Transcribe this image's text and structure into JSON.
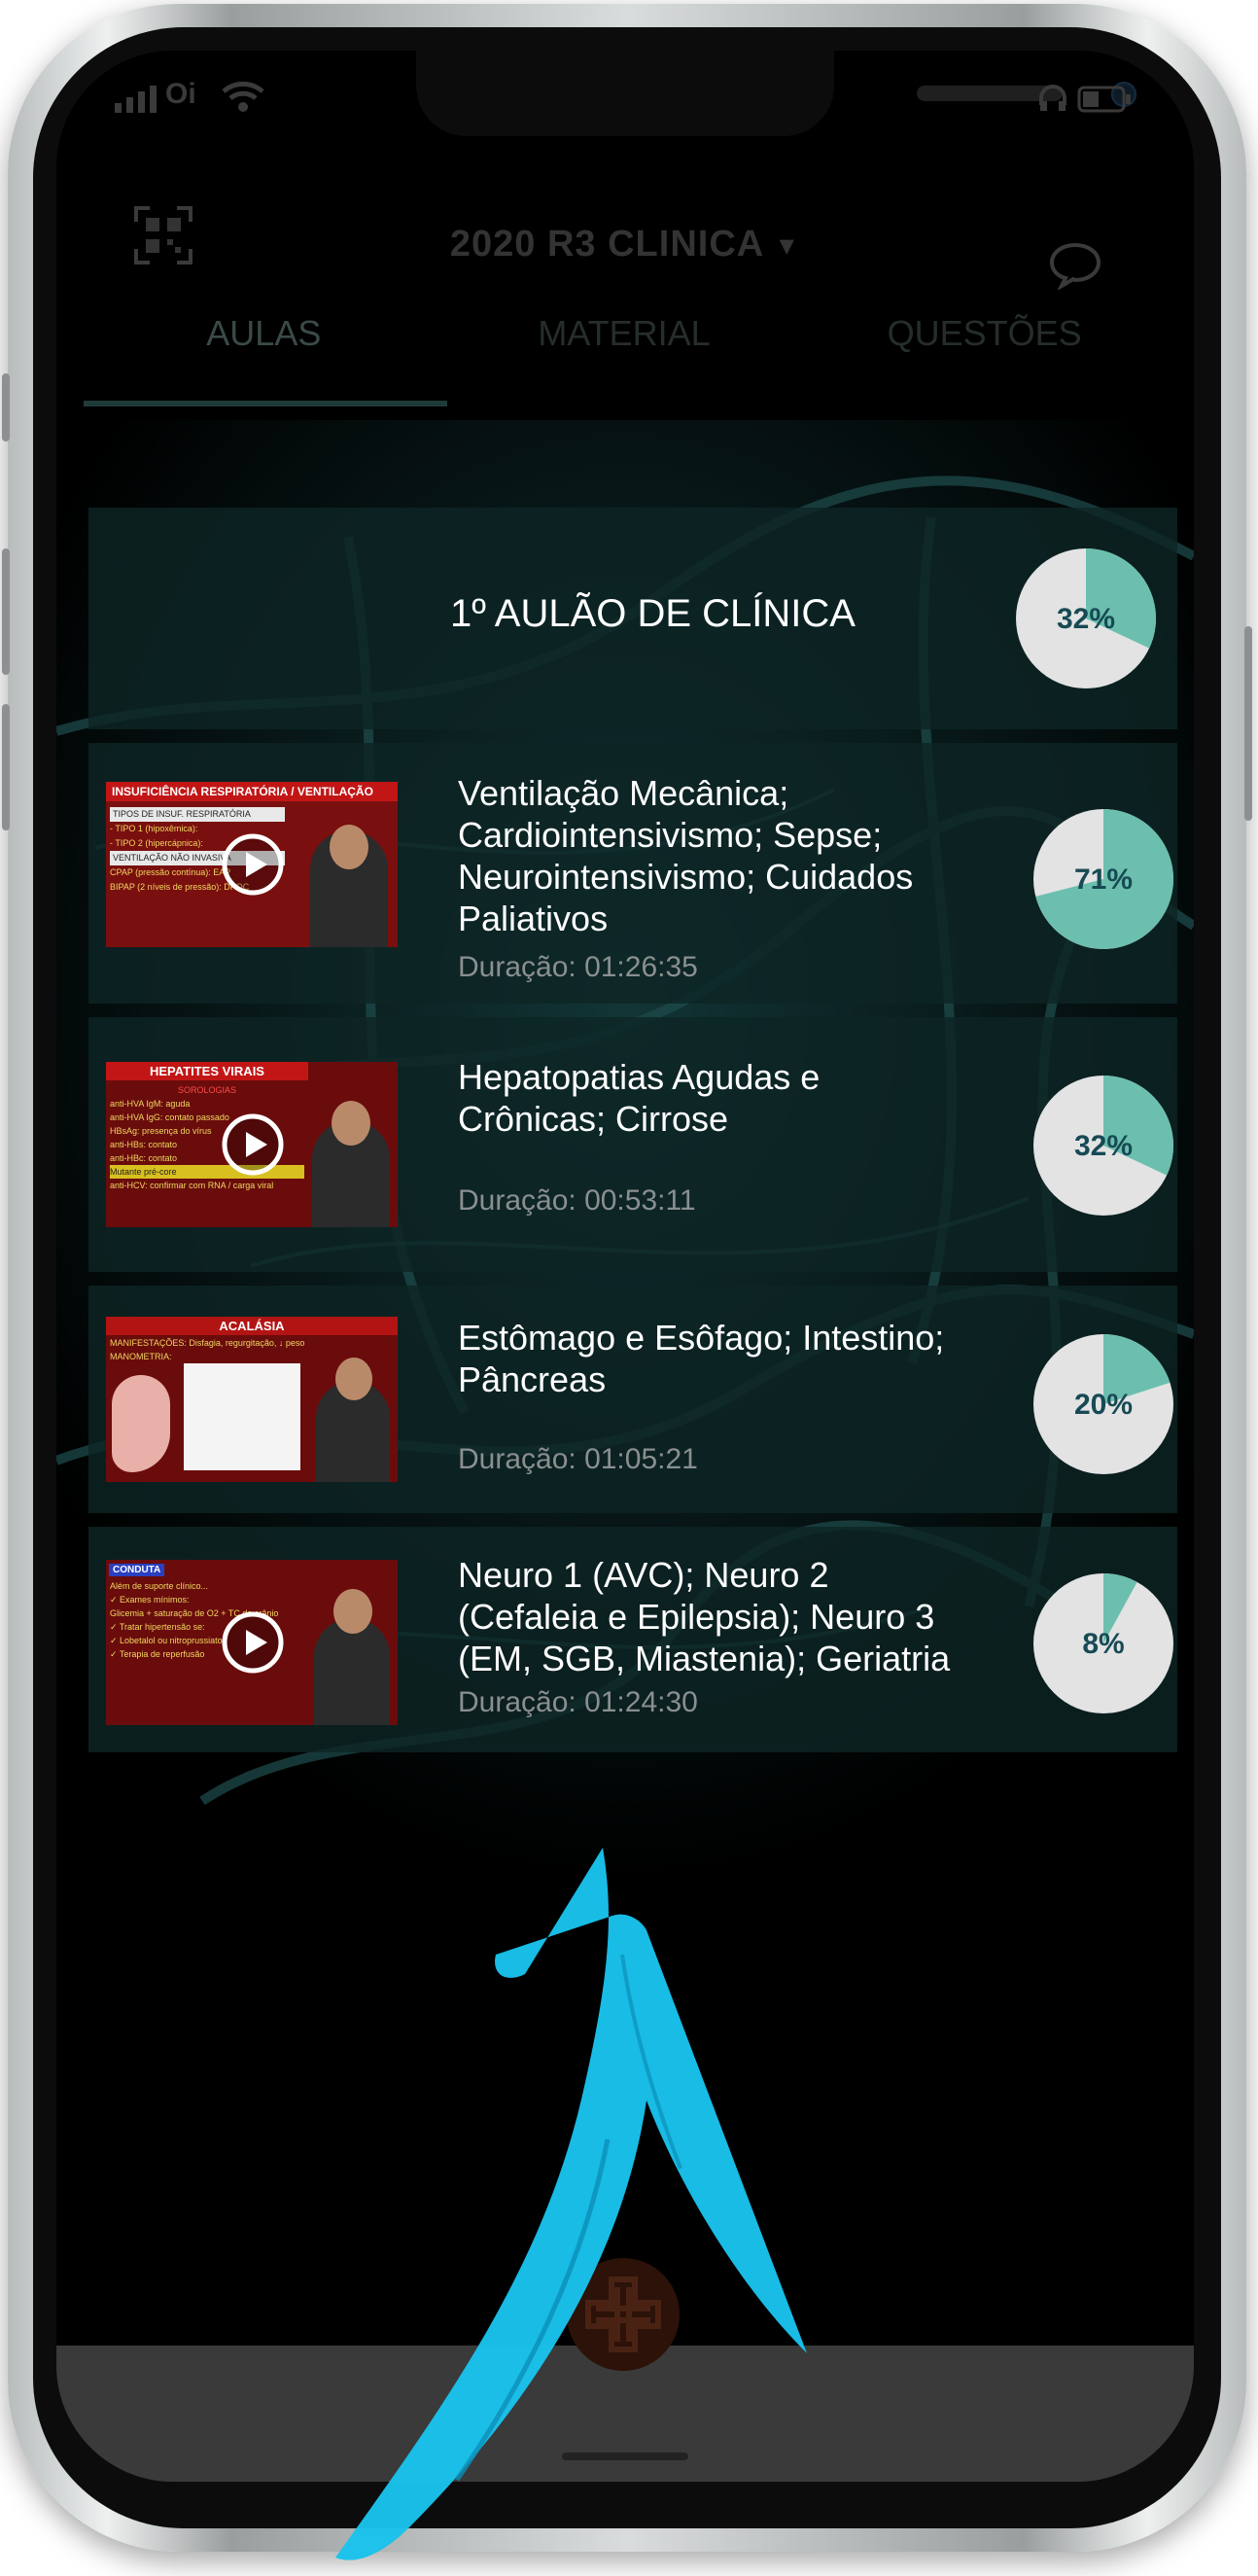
{
  "status_bar": {
    "carrier": "Oi"
  },
  "header": {
    "title": "2020 R3 CLINICA",
    "dropdown_icon": "caret-down-icon",
    "left_icon": "qr-code-icon",
    "right_icon": "chat-bubble-icon"
  },
  "tabs": [
    {
      "label": "AULAS"
    },
    {
      "label": "MATERIAL"
    },
    {
      "label": "QUESTÕES"
    }
  ],
  "course": {
    "title": "1º AULÃO DE CLÍNICA",
    "progress_label": "32%",
    "progress": 0.32
  },
  "lessons": [
    {
      "title_lines": [
        "Ventilação Mecânica;",
        "Cardiointensivismo; Sepse;",
        "Neurointensivismo; Cuidados",
        "Paliativos"
      ],
      "duration": "Duração: 01:26:35",
      "progress_label": "71%",
      "progress": 0.71,
      "thumb": {
        "heading": "INSUFICIÊNCIA RESPIRATÓRIA / VENTILAÇÃO",
        "lines": [
          "TIPOS DE INSUF. RESPIRATÓRIA",
          "- TIPO 1 (hipoxêmica):",
          "- TIPO 2 (hipercápnica):",
          "VENTILAÇÃO NÃO INVASIVA",
          "CPAP (pressão contínua): EAP",
          "BIPAP (2 níveis de pressão): DPOC"
        ]
      }
    },
    {
      "title_lines": [
        "Hepatopatias Agudas e",
        "Crônicas; Cirrose"
      ],
      "duration": "Duração: 00:53:11",
      "progress_label": "32%",
      "progress": 0.32,
      "thumb": {
        "heading": "HEPATITES VIRAIS",
        "lines": [
          "SOROLOGIAS",
          "anti-HVA IgM: aguda",
          "anti-HVA IgG: contato passado",
          "HBsAg: presença do vírus",
          "anti-HBs: contato",
          "anti-HBc: contato",
          "Mutante pré-core",
          "anti-HCV: confirmar com RNA / carga viral"
        ]
      }
    },
    {
      "title_lines": [
        "Estômago e Esôfago; Intestino;",
        "Pâncreas"
      ],
      "duration": "Duração: 01:05:21",
      "progress_label": "20%",
      "progress": 0.2,
      "thumb": {
        "heading": "ACALÁSIA",
        "lines": [
          "MANIFESTAÇÕES: Disfagia, regurgitação, ↓ peso",
          "MANOMETRIA:"
        ]
      }
    },
    {
      "title_lines": [
        "Neuro 1 (AVC); Neuro 2",
        "(Cefaleia e Epilepsia); Neuro 3",
        "(EM, SGB, Miastenia); Geriatria"
      ],
      "duration": "Duração: 01:24:30",
      "progress_label": "8%",
      "progress": 0.08,
      "thumb": {
        "heading": "CONDUTA",
        "lines": [
          "Além de suporte clínico...",
          "✓ Exames mínimos:",
          "Glicemia + saturação de O2 + TC de crânio",
          "✓ Tratar hipertensão se:",
          "✓ Lobetalol ou nitroprussiato",
          "✓ Terapia de reperfusão"
        ]
      }
    }
  ],
  "colors": {
    "accent": "#6cbfae",
    "pie_bg": "#e3e3e3",
    "pie_text": "#174a55",
    "row_bg": "#0e2424",
    "arrow": "#19c2ec"
  },
  "home_icon": "medical-cross-icon",
  "play_icon": "play-icon"
}
